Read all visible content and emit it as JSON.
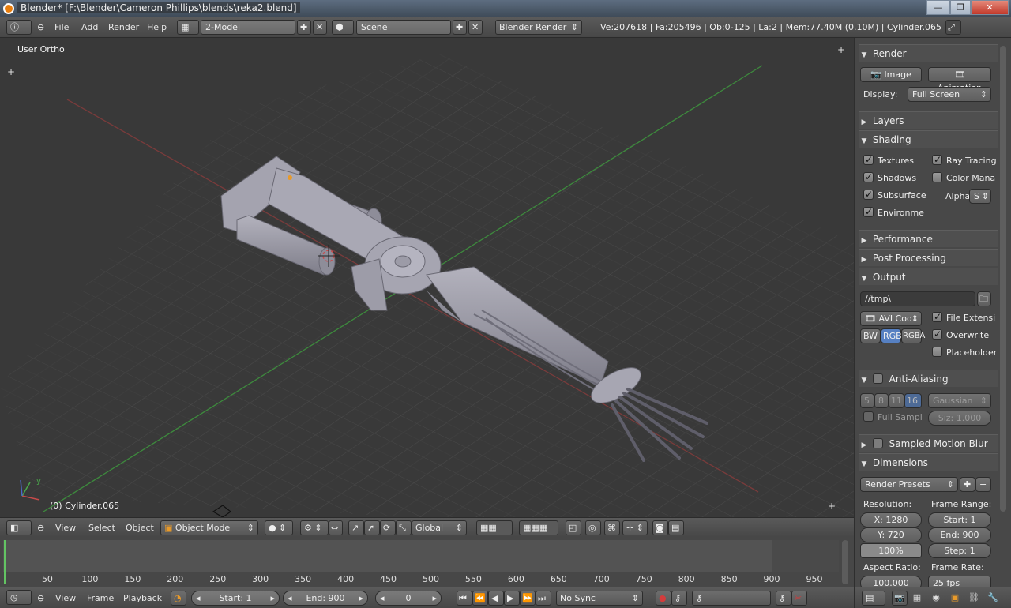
{
  "window": {
    "title": "Blender* [F:\\Blender\\Cameron Phillips\\blends\\reka2.blend]",
    "minimize": "—",
    "maximize": "❐",
    "close": "✕"
  },
  "info_header": {
    "menus": [
      "File",
      "Add",
      "Render",
      "Help"
    ],
    "screen_layout": "2-Model",
    "scene": "Scene",
    "engine": "Blender Render",
    "stats": "Ve:207618 | Fa:205496 | Ob:0-125 | La:2 | Mem:77.40M (0.10M) | Cylinder.065"
  },
  "viewport": {
    "view_label": "User Ortho",
    "object_label": "(0) Cylinder.065",
    "axis_y": "y"
  },
  "viewport_header": {
    "menus": [
      "View",
      "Select",
      "Object"
    ],
    "mode": "Object Mode",
    "orientation": "Global"
  },
  "timeline": {
    "ruler": [
      "50",
      "100",
      "150",
      "200",
      "250",
      "300",
      "350",
      "400",
      "450",
      "500",
      "550",
      "600",
      "650",
      "700",
      "750",
      "800",
      "850",
      "900",
      "950"
    ],
    "menus": [
      "View",
      "Frame",
      "Playback"
    ],
    "start": "Start: 1",
    "end": "End: 900",
    "current": "0",
    "sync": "No Sync"
  },
  "properties": {
    "render": {
      "header": "Render",
      "image_button": "Image",
      "animation_button": "Animation",
      "display_label": "Display:",
      "display_value": "Full Screen"
    },
    "layers": {
      "header": "Layers"
    },
    "shading": {
      "header": "Shading",
      "textures": "Textures",
      "ray_tracing": "Ray Tracing",
      "shadows": "Shadows",
      "color_mana": "Color Mana",
      "subsurface": "Subsurface",
      "alpha_label": "Alpha:",
      "alpha_value": "S",
      "environment": "Environme"
    },
    "performance": {
      "header": "Performance"
    },
    "post_processing": {
      "header": "Post Processing"
    },
    "output": {
      "header": "Output",
      "path": "//tmp\\",
      "codec": "AVI Cod",
      "file_ext": "File Extensi",
      "overwrite": "Overwrite",
      "placeholder": "Placeholder",
      "bw": "BW",
      "rgb": "RGB",
      "rgba": "RGBA"
    },
    "anti_aliasing": {
      "header": "Anti-Aliasing",
      "samples": [
        "5",
        "8",
        "11",
        "16"
      ],
      "filter": "Gaussian",
      "full_sample": "Full Sampl",
      "size": "Siz: 1.000"
    },
    "motion_blur": {
      "header": "Sampled Motion Blur"
    },
    "dimensions": {
      "header": "Dimensions",
      "presets": "Render Presets",
      "resolution_label": "Resolution:",
      "frame_range_label": "Frame Range:",
      "res_x": "X: 1280",
      "res_y": "Y: 720",
      "res_pct": "100%",
      "start": "Start: 1",
      "end": "End: 900",
      "step": "Step: 1",
      "aspect_label": "Aspect Ratio:",
      "frame_rate_label": "Frame Rate:",
      "aspect_value": "100.000",
      "frame_rate_value": "25 fps"
    }
  },
  "colors": {
    "grid_x_axis": "#8a3a3a",
    "grid_y_axis": "#3a8a3a",
    "accent_blue": "#5680c2",
    "timeline_cursor": "#63c463",
    "model_gray": "#9a99a6"
  }
}
